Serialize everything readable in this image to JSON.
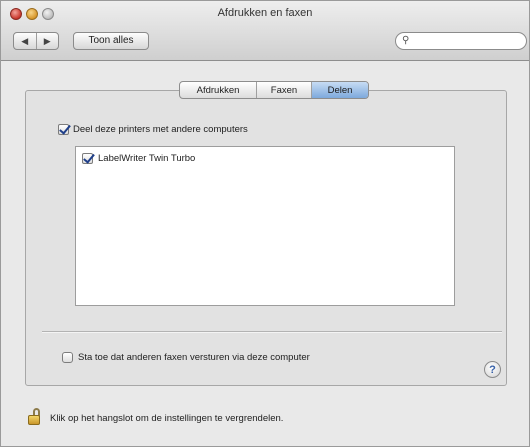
{
  "window": {
    "title": "Afdrukken en faxen"
  },
  "toolbar": {
    "back_icon": "◀",
    "forward_icon": "▶",
    "show_all_label": "Toon alles",
    "search": {
      "placeholder": "",
      "value": ""
    }
  },
  "tabs": [
    {
      "label": "Afdrukken",
      "active": false
    },
    {
      "label": "Faxen",
      "active": false
    },
    {
      "label": "Delen",
      "active": true
    }
  ],
  "sharing": {
    "share_printers_label": "Deel deze printers met andere computers",
    "share_printers_checked": true,
    "printers": [
      {
        "name": "LabelWriter Twin Turbo",
        "checked": true
      }
    ],
    "fax_label": "Sta toe dat anderen faxen versturen via deze computer",
    "fax_checked": false
  },
  "help_glyph": "?",
  "lock_text": "Klik op het hangslot om de instellingen te vergrendelen.",
  "colors": {
    "active_tab": "#7ea9dc",
    "checkmark": "#1f3f8a",
    "help": "#3660a8"
  }
}
